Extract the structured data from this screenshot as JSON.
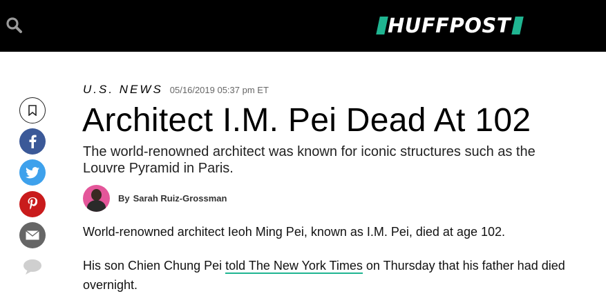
{
  "header": {
    "logo_text": "HUFFPOST",
    "brand_color": "#1fb591",
    "search_icon": "search-icon"
  },
  "share": {
    "items": [
      {
        "icon": "bookmark-icon"
      },
      {
        "icon": "facebook-icon",
        "color": "#3b5998"
      },
      {
        "icon": "twitter-icon",
        "color": "#3ea1ec"
      },
      {
        "icon": "pinterest-icon",
        "color": "#c91b1c"
      },
      {
        "icon": "mail-icon",
        "color": "#666666"
      },
      {
        "icon": "comment-icon"
      }
    ]
  },
  "article": {
    "section": "U.S. NEWS",
    "timestamp": "05/16/2019 05:37 pm ET",
    "headline": "Architect I.M. Pei Dead At 102",
    "dek": "The world-renowned architect was known for iconic structures such as the Louvre Pyramid in Paris.",
    "byline": {
      "prefix": "By",
      "author": "Sarah Ruiz-Grossman"
    },
    "paragraphs": {
      "p1": "World-renowned architect Ieoh Ming Pei, known as I.M. Pei, died at age 102.",
      "p2_before": "His son Chien Chung Pei ",
      "p2_link": "told The New York Times",
      "p2_after": " on Thursday that his father had died overnight."
    }
  }
}
